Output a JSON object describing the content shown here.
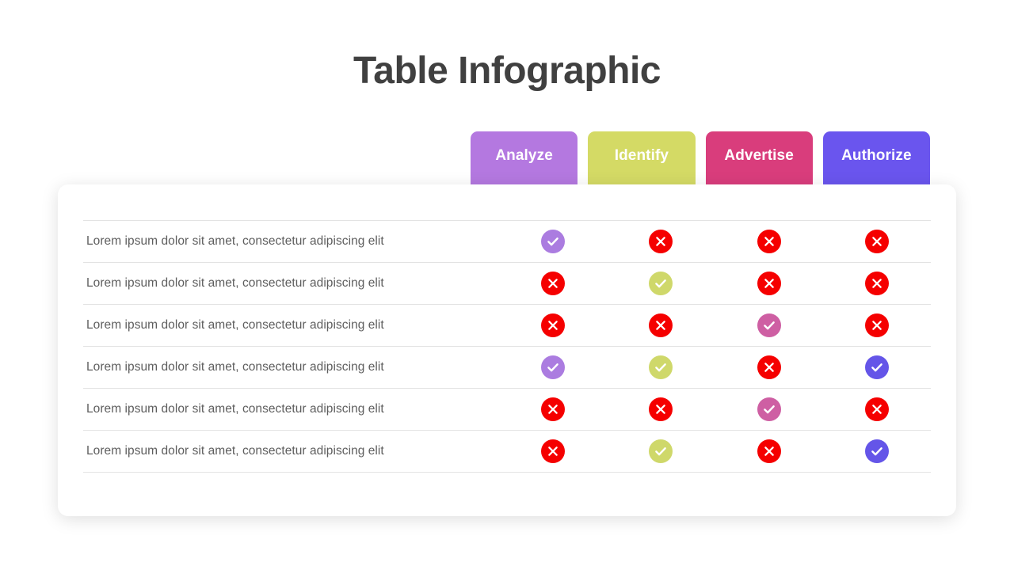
{
  "page": {
    "title": "Table Infographic",
    "background_color": "#ffffff",
    "title_color": "#404040"
  },
  "colors": {
    "analyze": "#b478e0",
    "identify": "#d4da65",
    "advertise": "#d93d7c",
    "authorize": "#6a55ee",
    "check_analyze": "#ab7ce0",
    "check_identify": "#cfd86a",
    "check_advertise": "#ce5fa3",
    "check_authorize": "#6455e8",
    "cross_red": "#f50000",
    "divider": "#e3e3e3",
    "row_label_text": "#5e5e5e",
    "header_text": "#ffffff"
  },
  "table": {
    "columns": [
      {
        "label": "Analyze",
        "color_key": "analyze",
        "check_color_key": "check_analyze"
      },
      {
        "label": "Identify",
        "color_key": "identify",
        "check_color_key": "check_identify"
      },
      {
        "label": "Advertise",
        "color_key": "advertise",
        "check_color_key": "check_advertise"
      },
      {
        "label": "Authorize",
        "color_key": "authorize",
        "check_color_key": "check_authorize"
      }
    ],
    "rows": [
      {
        "label": "Lorem ipsum dolor sit amet, consectetur adipiscing elit",
        "values": [
          "check",
          "cross",
          "cross",
          "cross"
        ]
      },
      {
        "label": "Lorem ipsum dolor sit amet, consectetur adipiscing elit",
        "values": [
          "cross",
          "check",
          "cross",
          "cross"
        ]
      },
      {
        "label": "Lorem ipsum dolor sit amet, consectetur adipiscing elit",
        "values": [
          "cross",
          "cross",
          "check",
          "cross"
        ]
      },
      {
        "label": "Lorem ipsum dolor sit amet, consectetur adipiscing elit",
        "values": [
          "check",
          "check",
          "cross",
          "check"
        ]
      },
      {
        "label": "Lorem ipsum dolor sit amet, consectetur adipiscing elit",
        "values": [
          "cross",
          "cross",
          "check",
          "cross"
        ]
      },
      {
        "label": "Lorem ipsum dolor sit amet, consectetur adipiscing elit",
        "values": [
          "cross",
          "check",
          "cross",
          "check"
        ]
      }
    ],
    "icon_names": {
      "check": "check-circle-icon",
      "cross": "cross-circle-icon"
    }
  }
}
